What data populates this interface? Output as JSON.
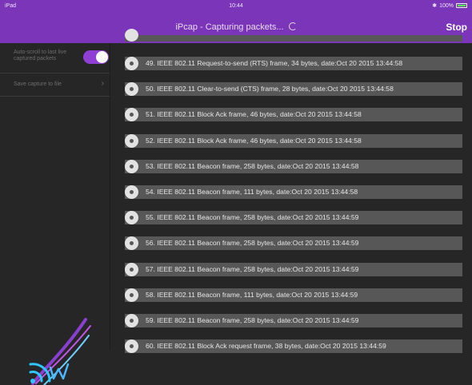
{
  "status_bar": {
    "carrier": "iPad",
    "time": "10:44",
    "battery_text": "100%"
  },
  "nav": {
    "title": "iPcap - Capturing packets...",
    "stop_label": "Stop"
  },
  "sidebar": {
    "autoscroll_label": "Auto-scroll to last live captured packets",
    "autoscroll_on": true,
    "save_label": "Save capture to file"
  },
  "colors": {
    "accent": "#7a35b8",
    "toggle": "#8f3fd6",
    "row_bg": "#575757",
    "background": "#262626"
  },
  "packets": [
    {
      "text": "49. IEEE 802.11 Request-to-send (RTS) frame, 34 bytes, date:Oct 20 2015 13:44:58"
    },
    {
      "text": "50. IEEE 802.11 Clear-to-send (CTS) frame, 28 bytes, date:Oct 20 2015 13:44:58"
    },
    {
      "text": "51. IEEE 802.11 Block Ack frame, 46 bytes, date:Oct 20 2015 13:44:58"
    },
    {
      "text": "52. IEEE 802.11 Block Ack frame, 46 bytes, date:Oct 20 2015 13:44:58"
    },
    {
      "text": "53. IEEE 802.11 Beacon frame, 258 bytes, date:Oct 20 2015 13:44:58"
    },
    {
      "text": "54. IEEE 802.11 Beacon frame, 111 bytes, date:Oct 20 2015 13:44:58"
    },
    {
      "text": "55. IEEE 802.11 Beacon frame, 258 bytes, date:Oct 20 2015 13:44:59"
    },
    {
      "text": "56. IEEE 802.11 Beacon frame, 258 bytes, date:Oct 20 2015 13:44:59"
    },
    {
      "text": "57. IEEE 802.11 Beacon frame, 258 bytes, date:Oct 20 2015 13:44:59"
    },
    {
      "text": "58. IEEE 802.11 Beacon frame, 111 bytes, date:Oct 20 2015 13:44:59"
    },
    {
      "text": "59. IEEE 802.11 Beacon frame, 258 bytes, date:Oct 20 2015 13:44:59"
    },
    {
      "text": "60. IEEE 802.11 Block Ack request frame, 38 bytes, date:Oct 20 2015 13:44:59"
    }
  ]
}
